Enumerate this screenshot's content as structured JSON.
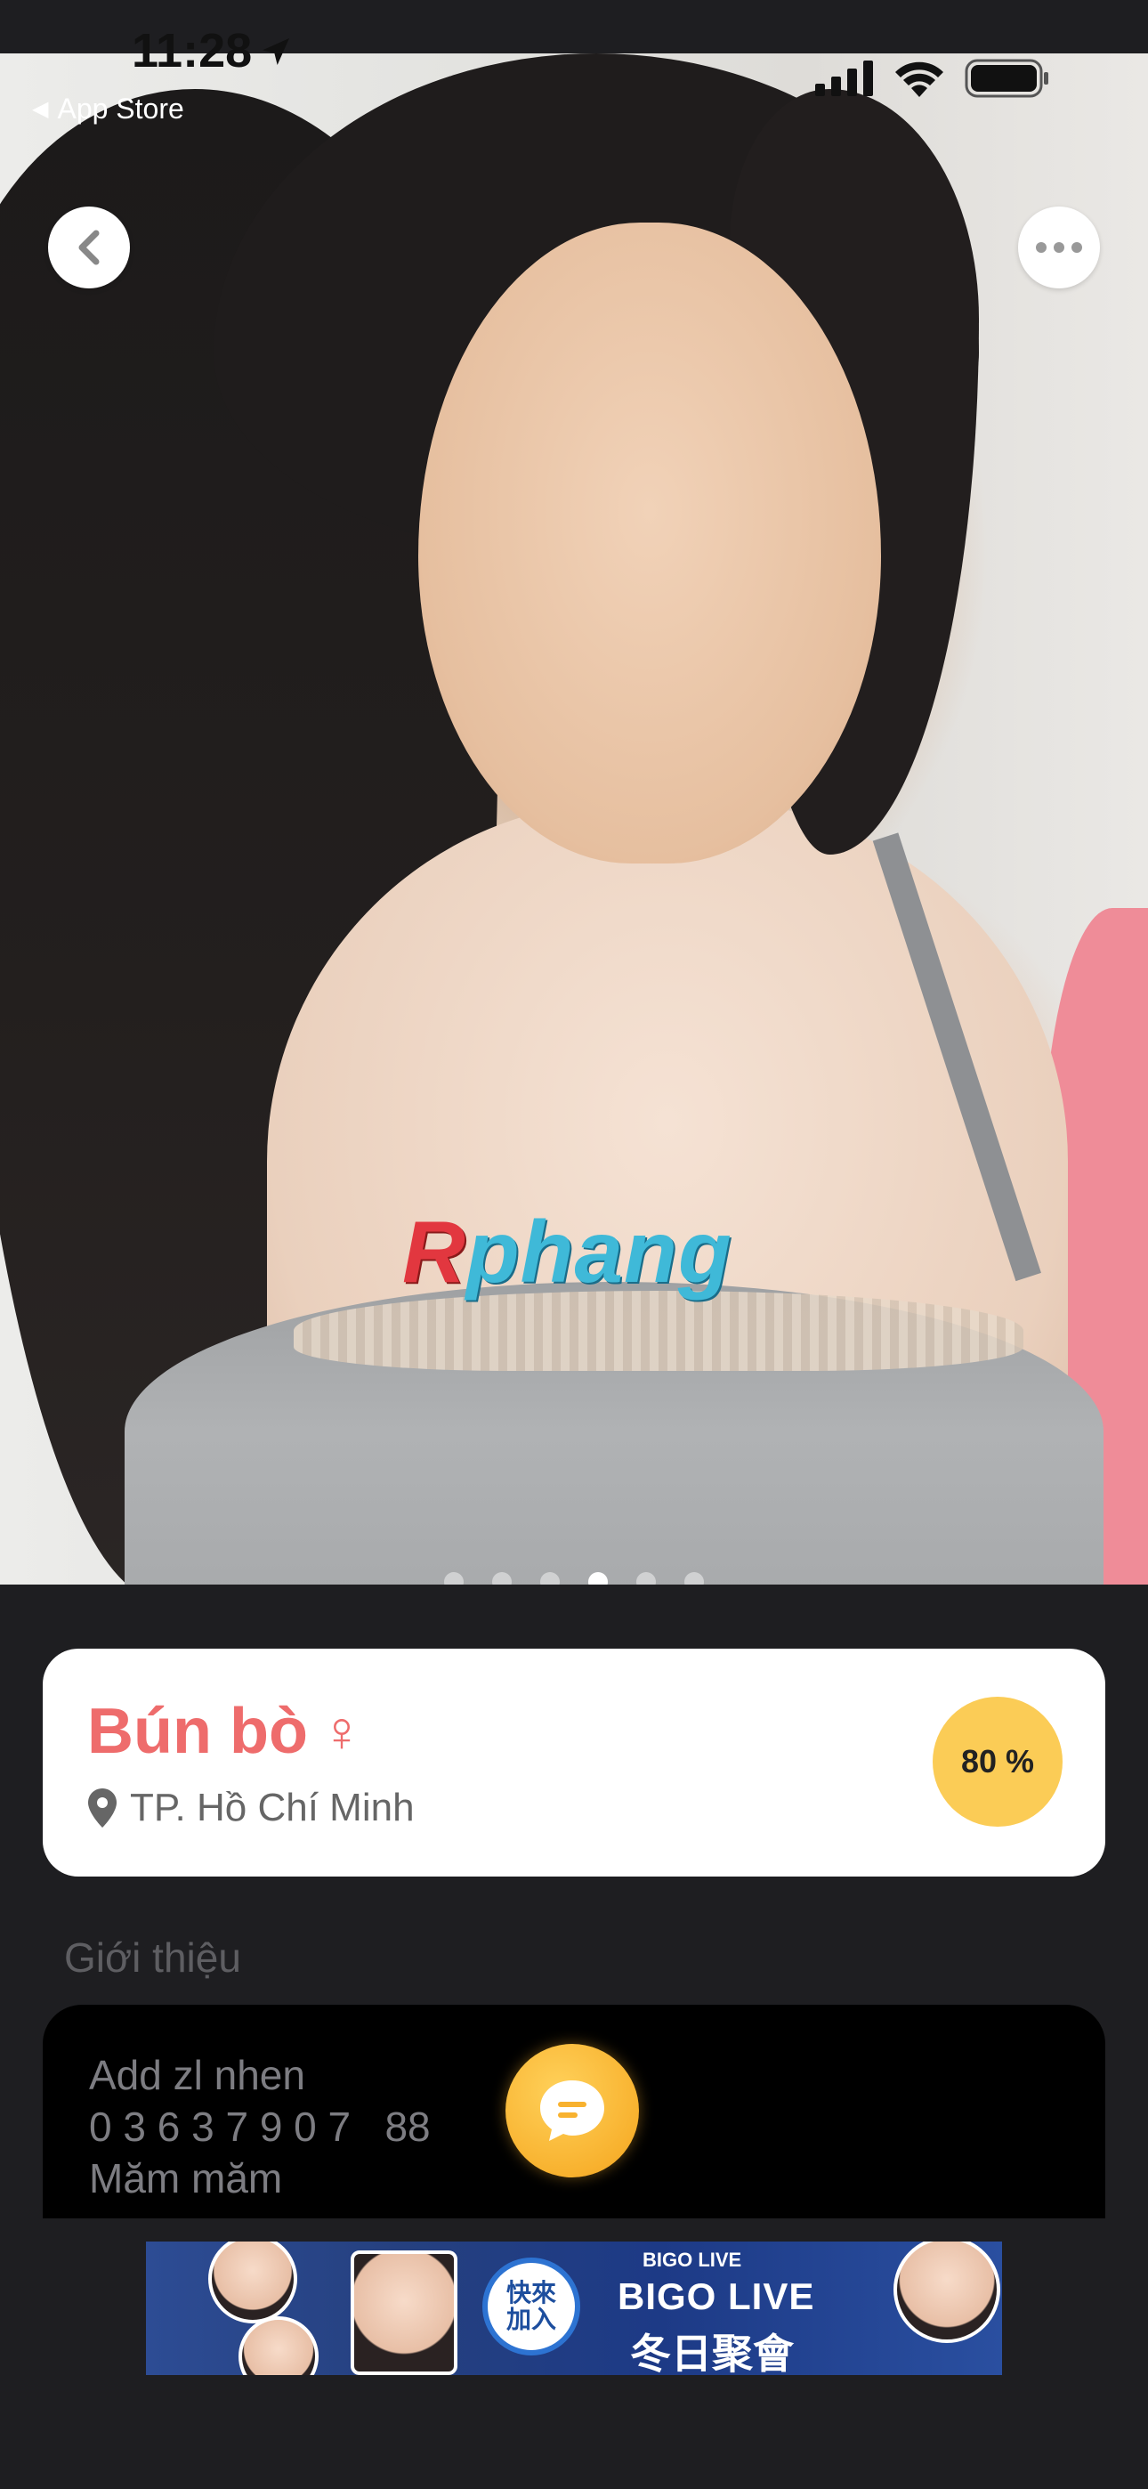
{
  "status_bar": {
    "time": "11:28",
    "back_app_label": "App Store"
  },
  "photo": {
    "watermark_first": "R",
    "watermark_rest": "phang",
    "page_count": 6,
    "active_page": 4
  },
  "profile": {
    "name": "Bún bò",
    "gender_symbol": "♀",
    "location": "TP. Hồ Chí Minh",
    "match_percent": "80 %"
  },
  "intro": {
    "section_title": "Giới thiệu",
    "text": "Add zl nhen\n0 3 6 3 7 9 0 7   88\nMăm măm"
  },
  "ad": {
    "brand": "BIGO LIVE",
    "title": "BIGO LIVE",
    "subtitle": "冬日聚會",
    "badge": "快來\n加入"
  },
  "colors": {
    "accent_name": "#ee6c6c",
    "match_badge": "#fbcc56",
    "chat_button": "#f8b22f",
    "background": "#1e1e21"
  },
  "icons": {
    "back": "chevron-left-icon",
    "more": "more-horizontal-icon",
    "location": "location-pin-icon",
    "gender": "female-icon",
    "chat": "chat-bubble-icon"
  }
}
